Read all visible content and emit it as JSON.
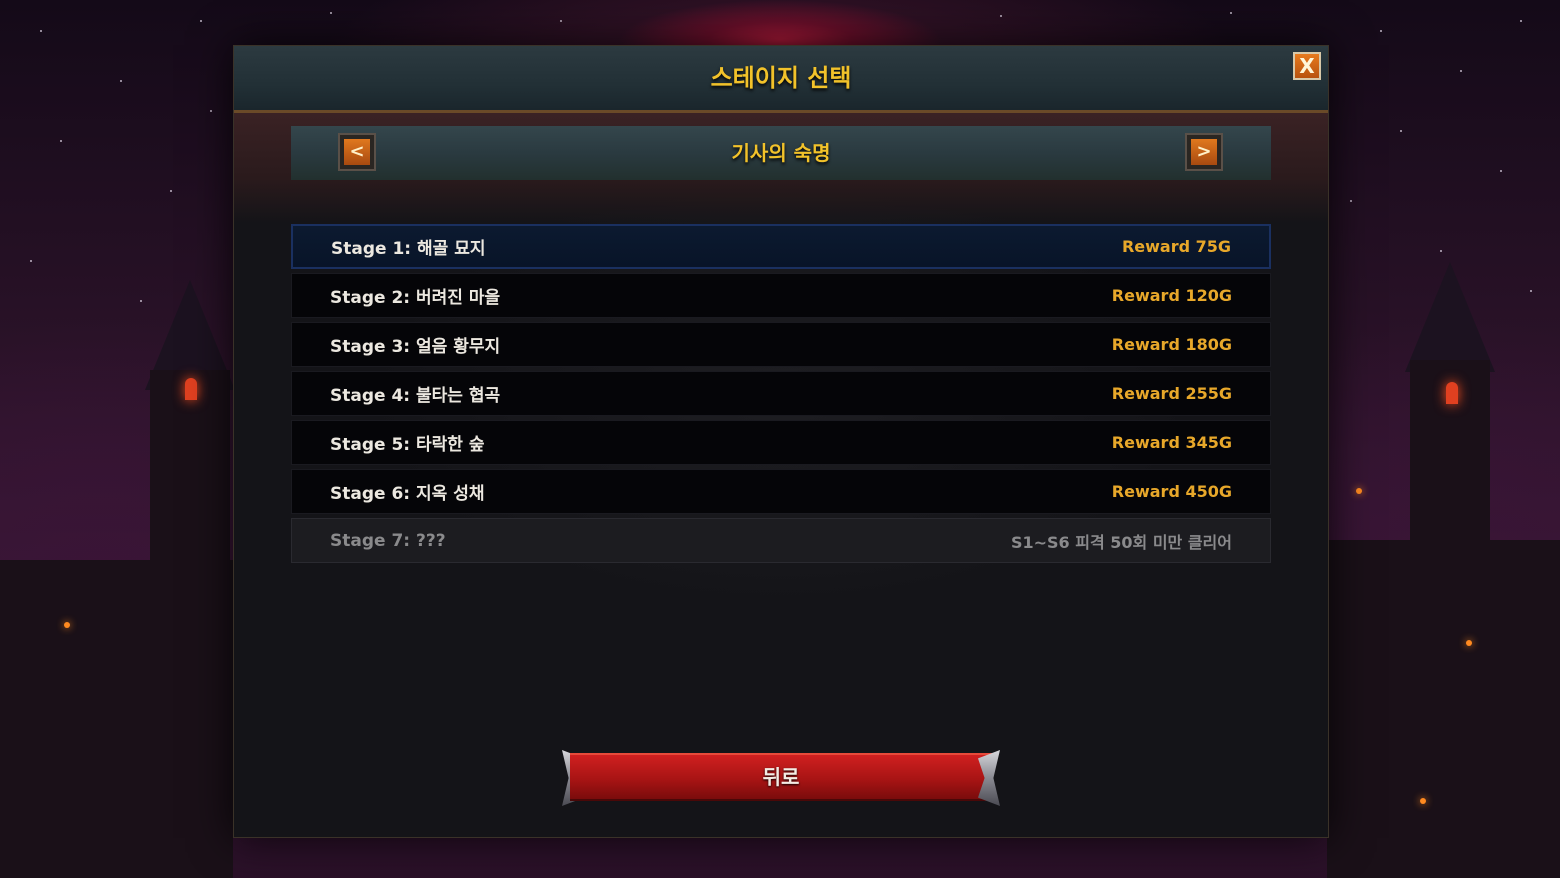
{
  "dialog": {
    "title": "스테이지 선택",
    "close_label": "X"
  },
  "chapter": {
    "title": "기사의 숙명",
    "prev_label": "<",
    "next_label": ">"
  },
  "stages": [
    {
      "name": "Stage 1: 해골 묘지",
      "reward": "Reward 75G",
      "state": "selected"
    },
    {
      "name": "Stage 2: 버려진 마을",
      "reward": "Reward 120G",
      "state": "unlocked"
    },
    {
      "name": "Stage 3: 얼음 황무지",
      "reward": "Reward 180G",
      "state": "unlocked"
    },
    {
      "name": "Stage 4: 불타는 협곡",
      "reward": "Reward 255G",
      "state": "unlocked"
    },
    {
      "name": "Stage 5: 타락한 숲",
      "reward": "Reward 345G",
      "state": "unlocked"
    },
    {
      "name": "Stage 6: 지옥 성채",
      "reward": "Reward 450G",
      "state": "unlocked"
    },
    {
      "name": "Stage 7: ???",
      "reward": "S1~S6 피격 50회 미만 클리어",
      "state": "locked"
    }
  ],
  "footer": {
    "back_label": "뒤로"
  },
  "colors": {
    "title_gold": "#f2c22a",
    "reward_gold": "#e8a82a",
    "selected_row": "#0c1a30",
    "back_button_red": "#c01a1a",
    "close_button_orange": "#e67a1e"
  }
}
